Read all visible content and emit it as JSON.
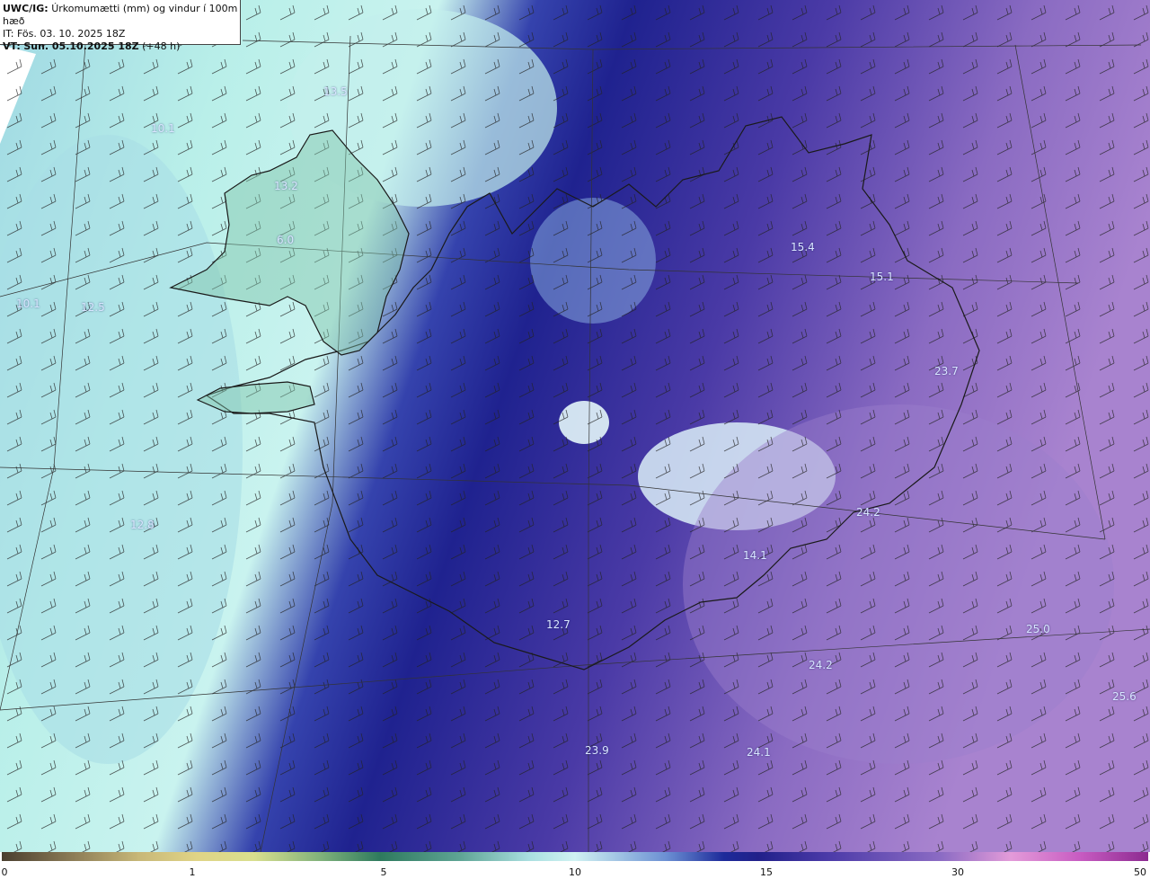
{
  "header": {
    "model_label": "UWC/IG:",
    "description": "Úrkomumætti (mm) og vindur í 100m hæð",
    "issue_time": "IT: Fös. 03. 10. 2025 18Z",
    "valid_label": "VT:",
    "valid_time": "Sun. 05.10.2025 18Z",
    "lead_time": "(+48 h)"
  },
  "map_values": [
    "13.5",
    "10.1",
    "13.2",
    "6.0",
    "10.1",
    "12.5",
    "12.8",
    "15.4",
    "15.1",
    "23.7",
    "24.2",
    "14.1",
    "12.7",
    "25.0",
    "24.2",
    "25.6",
    "23.9",
    "24.1"
  ],
  "colorbar": {
    "ticks": [
      "0",
      "1",
      "5",
      "10",
      "15",
      "30",
      "50"
    ]
  },
  "colors": {
    "low_precip": "#b7ebe8",
    "mid_precip": "#1e2a9e",
    "high_precip": "#9a76c8",
    "land_outline": "#222222"
  }
}
